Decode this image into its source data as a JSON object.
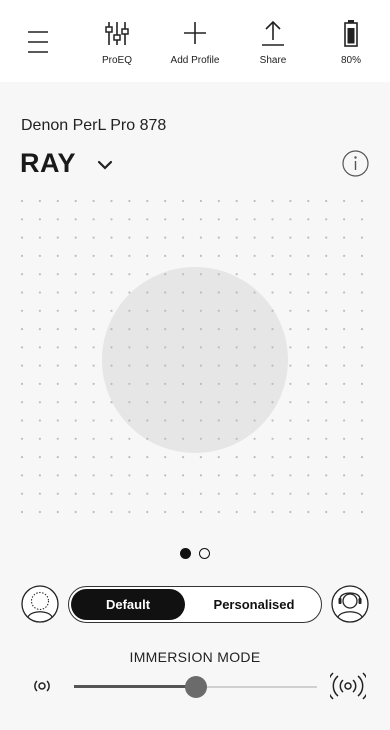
{
  "toolbar": {
    "menu_icon": "hamburger-menu-icon",
    "items": [
      {
        "label": "ProEQ",
        "icon": "equalizer-sliders-icon"
      },
      {
        "label": "Add Profile",
        "icon": "plus-icon"
      },
      {
        "label": "Share",
        "icon": "share-upload-icon"
      },
      {
        "label": "80%",
        "icon": "battery-icon"
      }
    ]
  },
  "device": {
    "name": "Denon PerL Pro 878",
    "profile": "RAY"
  },
  "pager": {
    "current": 1,
    "total": 2
  },
  "sound_mode": {
    "options": [
      "Default",
      "Personalised"
    ],
    "selected": "Default"
  },
  "immersion": {
    "label": "IMMERSION MODE",
    "level": 0.5
  },
  "colors": {
    "accent": "#111111",
    "background": "#f7f7f7",
    "toolbar": "#ffffff",
    "circle": "#e6e6e6"
  }
}
